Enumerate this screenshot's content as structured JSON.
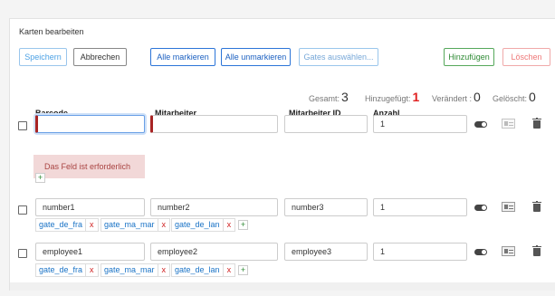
{
  "title": "Karten bearbeiten",
  "toolbar": {
    "save": "Speichern",
    "cancel": "Abbrechen",
    "mark_all": "Alle markieren",
    "unmark_all": "Alle unmarkieren",
    "select_gates": "Gates auswählen...",
    "add": "Hinzufügen",
    "delete": "Löschen"
  },
  "stats": {
    "total_label": "Gesamt:",
    "total": "3",
    "added_label": "Hinzugefügt:",
    "added": "1",
    "changed_label": "Verändert :",
    "changed": "0",
    "deleted_label": "Gelöscht:",
    "deleted": "0"
  },
  "columns": {
    "barcode": "Barcode",
    "employee": "Mitarbeiter",
    "employee_id": "Mitarbeiter ID",
    "count": "Anzahl"
  },
  "rows": [
    {
      "barcode": "",
      "employee": "",
      "employee_id": "",
      "count": "1",
      "error": "Das Feld ist erforderlich"
    },
    {
      "barcode": "number1",
      "employee": "number2",
      "employee_id": "number3",
      "count": "1",
      "gates": [
        "gate_de_fra",
        "gate_ma_mar",
        "gate_de_lan"
      ]
    },
    {
      "barcode": "employee1",
      "employee": "employee2",
      "employee_id": "employee3",
      "count": "1",
      "gates": [
        "gate_de_fra",
        "gate_ma_mar",
        "gate_de_lan"
      ]
    }
  ],
  "glyphs": {
    "plus": "+",
    "remove": "x"
  },
  "colors": {
    "primary": "#2c75d8",
    "success": "#2e8a34",
    "danger": "#e02020",
    "error_bg": "#f2d8d8"
  },
  "icons": [
    "toggle-icon",
    "id-card-icon",
    "trash-icon",
    "plus-icon"
  ]
}
